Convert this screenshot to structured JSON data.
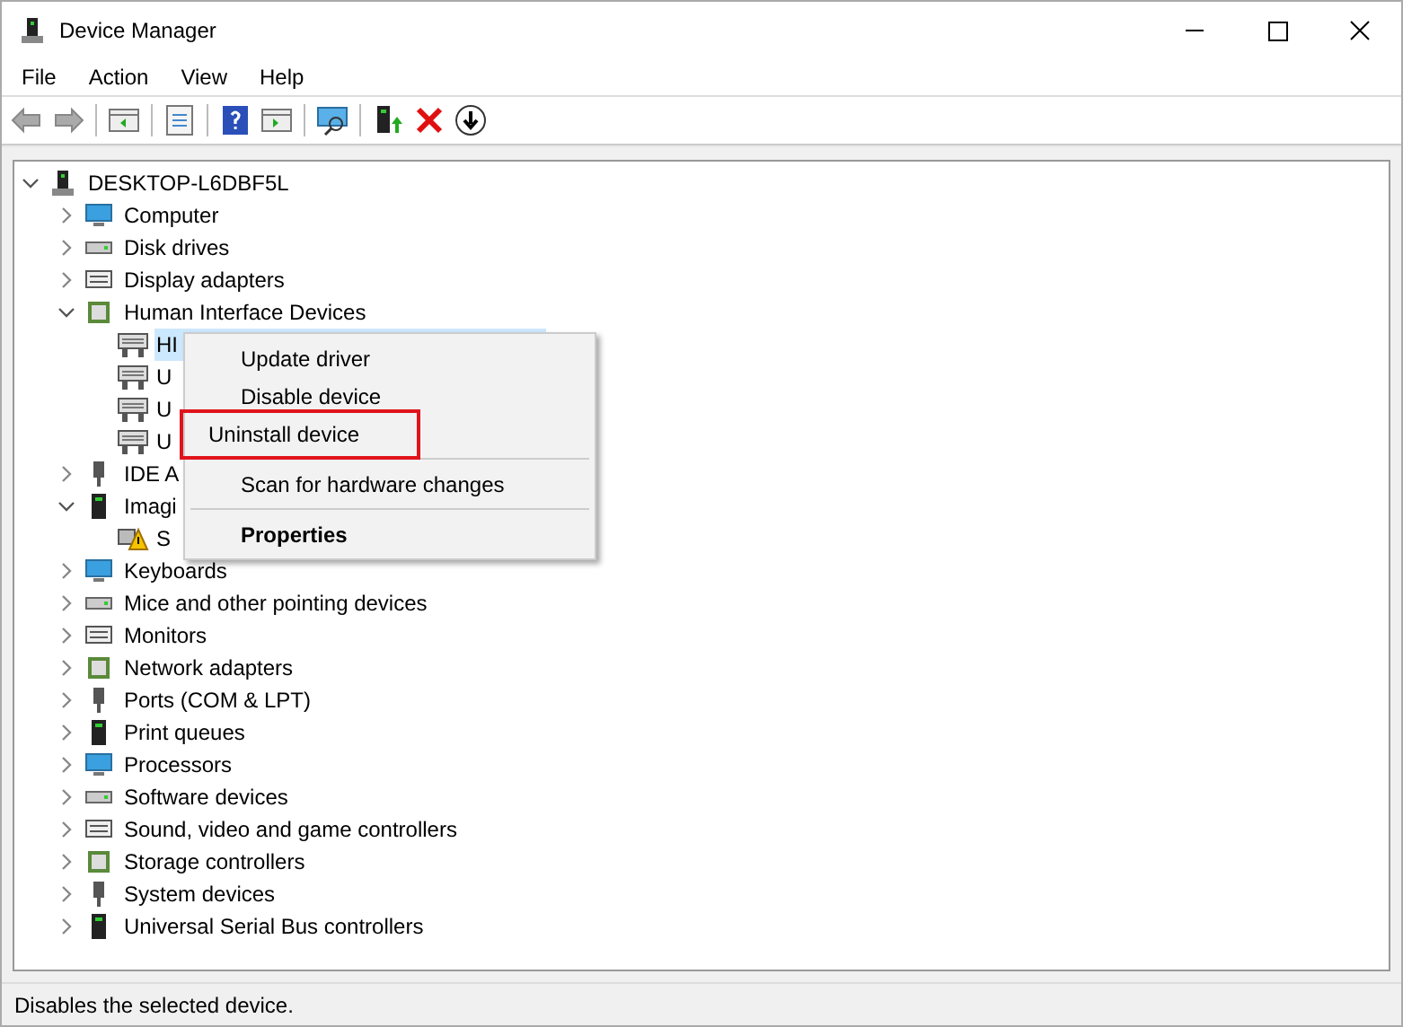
{
  "window": {
    "title": "Device Manager"
  },
  "menu": [
    "File",
    "Action",
    "View",
    "Help"
  ],
  "tree": {
    "label": "DESKTOP-L6DBF5L",
    "expanded": true,
    "children": [
      {
        "label": "Computer",
        "expanded": false
      },
      {
        "label": "Disk drives",
        "expanded": false
      },
      {
        "label": "Display adapters",
        "expanded": false
      },
      {
        "label": "Human Interface Devices",
        "expanded": true,
        "children": [
          {
            "label": "HI",
            "selected": true,
            "warning": false
          },
          {
            "label": "U",
            "selected": false,
            "warning": false
          },
          {
            "label": "U",
            "selected": false,
            "warning": false
          },
          {
            "label": "U",
            "selected": false,
            "warning": false
          }
        ]
      },
      {
        "label": "IDE A",
        "expanded": false
      },
      {
        "label": "Imagi",
        "expanded": true,
        "children": [
          {
            "label": "S",
            "selected": false,
            "warning": true
          }
        ]
      },
      {
        "label": "Keyboards",
        "expanded": false
      },
      {
        "label": "Mice and other pointing devices",
        "expanded": false
      },
      {
        "label": "Monitors",
        "expanded": false
      },
      {
        "label": "Network adapters",
        "expanded": false
      },
      {
        "label": "Ports (COM & LPT)",
        "expanded": false
      },
      {
        "label": "Print queues",
        "expanded": false
      },
      {
        "label": "Processors",
        "expanded": false
      },
      {
        "label": "Software devices",
        "expanded": false
      },
      {
        "label": "Sound, video and game controllers",
        "expanded": false
      },
      {
        "label": "Storage controllers",
        "expanded": false
      },
      {
        "label": "System devices",
        "expanded": false
      },
      {
        "label": "Universal Serial Bus controllers",
        "expanded": false
      }
    ]
  },
  "context_menu": [
    {
      "label": "Update driver",
      "outlined": false,
      "bold": false,
      "separator_before": false
    },
    {
      "label": "Disable device",
      "outlined": false,
      "bold": false,
      "separator_before": false
    },
    {
      "label": "Uninstall device",
      "outlined": true,
      "bold": false,
      "separator_before": false
    },
    {
      "label": "Scan for hardware changes",
      "outlined": false,
      "bold": false,
      "separator_before": true
    },
    {
      "label": "Properties",
      "outlined": false,
      "bold": true,
      "separator_before": true
    }
  ],
  "status_bar": "Disables the selected device."
}
